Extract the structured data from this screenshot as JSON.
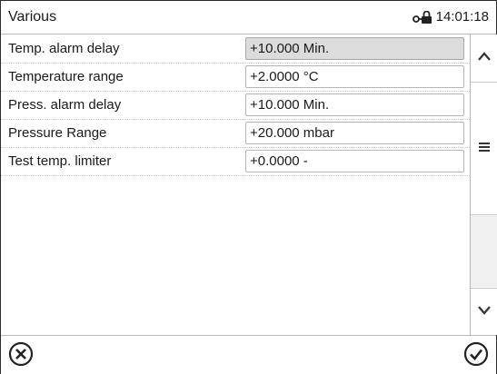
{
  "header": {
    "title": "Various",
    "time": "14:01:18",
    "lock_icon": "lock-icon"
  },
  "rows": [
    {
      "label": "Temp. alarm delay",
      "value": "+10.000 Min.",
      "selected": true
    },
    {
      "label": "Temperature range",
      "value": "+2.0000 °C",
      "selected": false
    },
    {
      "label": "Press. alarm delay",
      "value": "+10.000 Min.",
      "selected": false
    },
    {
      "label": "Pressure Range",
      "value": "+20.000 mbar",
      "selected": false
    },
    {
      "label": "Test temp. limiter",
      "value": "+0.0000 -",
      "selected": false
    }
  ],
  "scrollbar": {
    "up_icon": "chevron-up-icon",
    "thumb_icon": "hamburger-icon",
    "down_icon": "chevron-down-icon"
  },
  "footer": {
    "cancel_icon": "close-circle-icon",
    "confirm_icon": "check-circle-icon"
  },
  "colors": {
    "selected_field_bg": "#dcdcdc",
    "border": "#b4b4b4",
    "text": "#1a1a1a"
  }
}
